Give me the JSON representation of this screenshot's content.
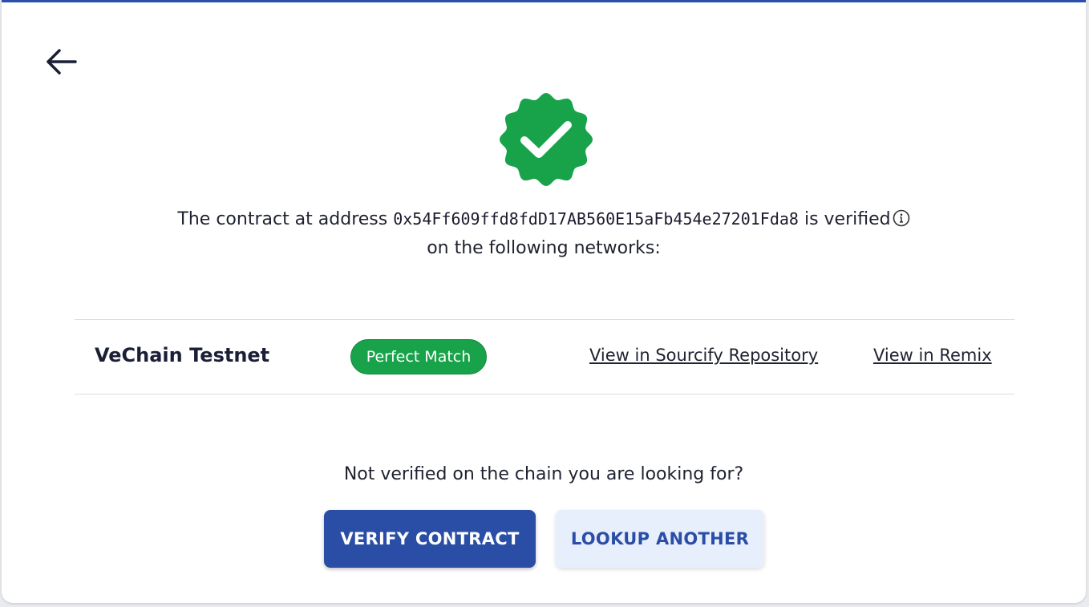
{
  "icons": {
    "back": "arrow-left-icon",
    "status": "verified-badge-check-icon",
    "info": "info-circle-icon"
  },
  "message": {
    "prefix": "The contract at address",
    "address": "0x54Ff609ffd8fdD17AB560E15aFb454e27201Fda8",
    "suffix": "is verified",
    "line2": "on the following networks:"
  },
  "networks": [
    {
      "name": "VeChain Testnet",
      "status": "Perfect Match",
      "link_sourcify": "View in Sourcify Repository",
      "link_remix": "View in Remix"
    }
  ],
  "prompt": "Not verified on the chain you are looking for?",
  "buttons": {
    "verify": "VERIFY CONTRACT",
    "lookup": "LOOKUP ANOTHER"
  },
  "colors": {
    "accent": "#2a4da6",
    "success": "#18a34a",
    "secondary_bg": "#e8effc"
  }
}
